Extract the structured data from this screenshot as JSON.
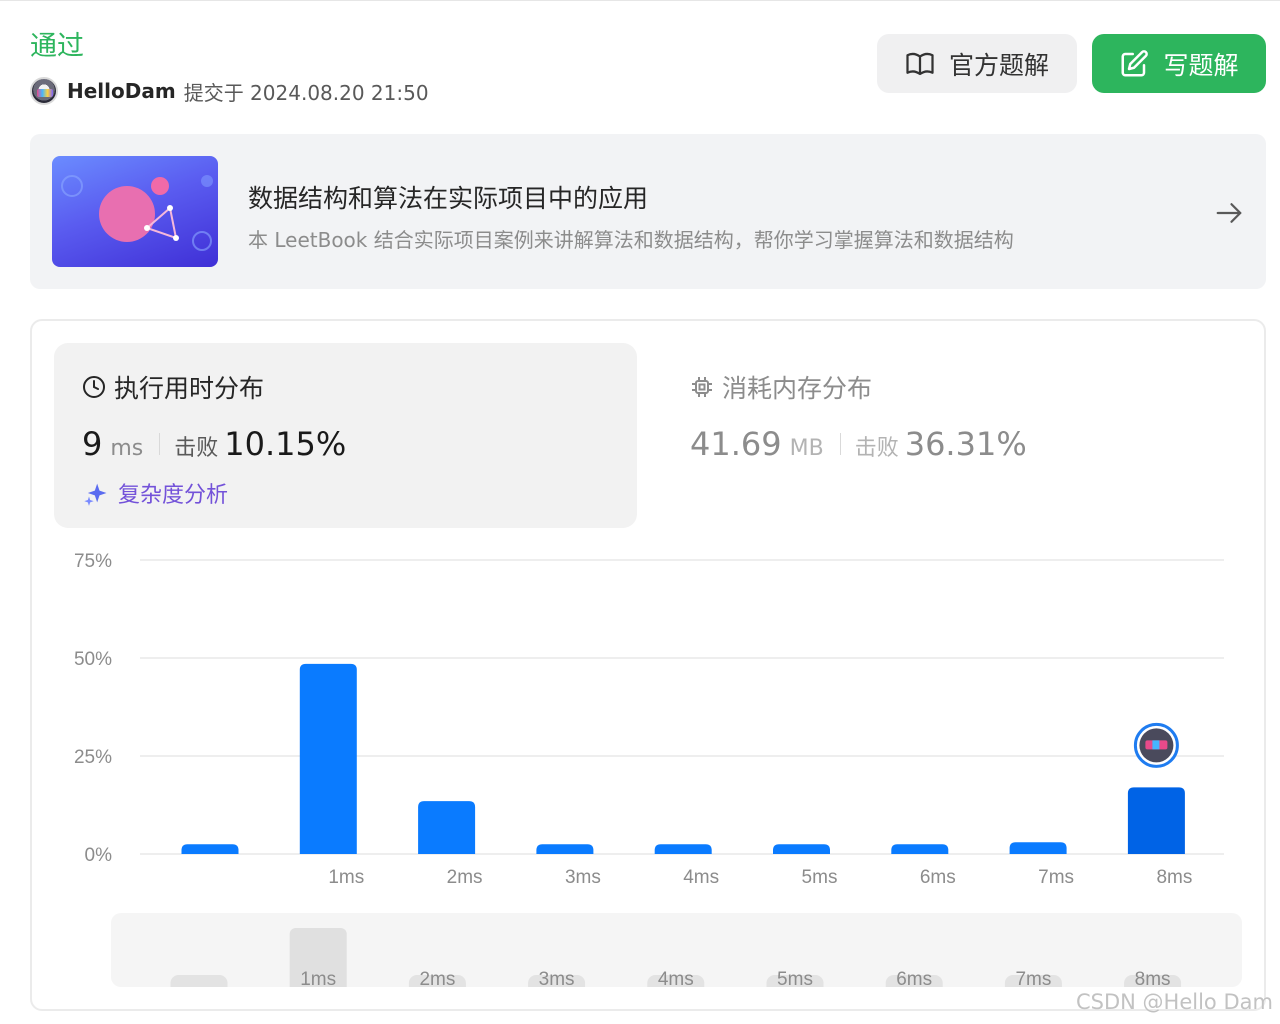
{
  "header": {
    "status": "通过",
    "user": "HelloDam",
    "submitted_text": "提交于 2024.08.20 21:50",
    "buttons": {
      "official": "官方题解",
      "write": "写题解"
    }
  },
  "banner": {
    "title": "数据结构和算法在实际项目中的应用",
    "subtitle": "本 LeetBook 结合实际项目案例来讲解算法和数据结构，帮你学习掌握算法和数据结构"
  },
  "runtime": {
    "heading": "执行用时分布",
    "value": "9",
    "unit": "ms",
    "beat_label": "击败",
    "beat_pct": "10.15%",
    "analysis_link": "复杂度分析"
  },
  "memory": {
    "heading": "消耗内存分布",
    "value": "41.69",
    "unit": "MB",
    "beat_label": "击败",
    "beat_pct": "36.31%"
  },
  "colors": {
    "accent_green": "#2db55d",
    "bar_blue": "#0a7bff",
    "bar_highlight": "#0063e6",
    "link_purple": "#7352d9"
  },
  "chart_data": {
    "type": "bar",
    "categories": [
      "",
      "1ms",
      "2ms",
      "3ms",
      "4ms",
      "5ms",
      "6ms",
      "7ms",
      "8ms"
    ],
    "values": [
      2.5,
      48.5,
      13.5,
      2.5,
      2.5,
      2.5,
      2.5,
      3,
      17
    ],
    "ylim": [
      0,
      75
    ],
    "yticks": [
      "0%",
      "25%",
      "50%",
      "75%"
    ],
    "highlight_index": 8,
    "grid": true,
    "overview": {
      "labels": [
        "",
        "1ms",
        "2ms",
        "3ms",
        "4ms",
        "5ms",
        "6ms",
        "7ms",
        "8ms"
      ],
      "selected_index": 1
    }
  },
  "watermark": "CSDN @Hello Dam"
}
